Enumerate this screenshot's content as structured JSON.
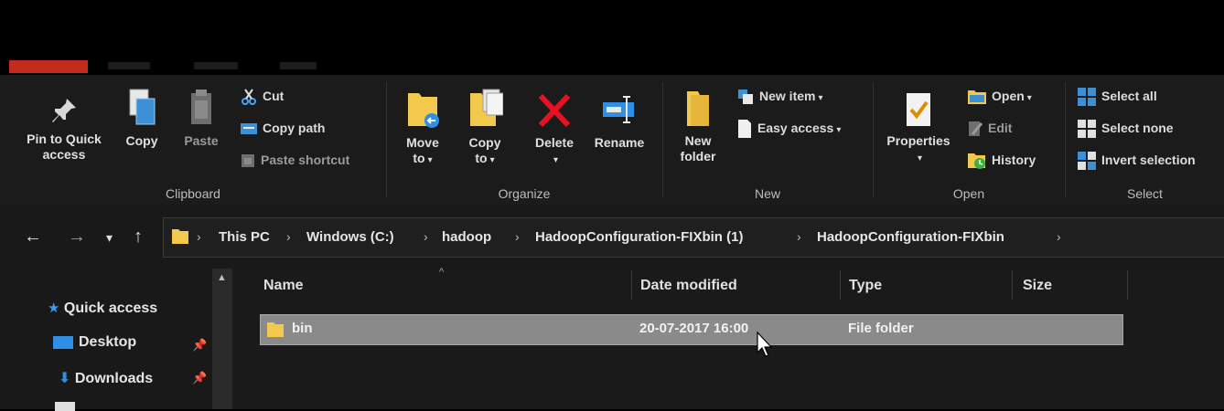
{
  "ribbon": {
    "clipboard": {
      "label": "Clipboard",
      "pin_line1": "Pin to Quick",
      "pin_line2": "access",
      "copy": "Copy",
      "paste": "Paste",
      "cut": "Cut",
      "copy_path": "Copy path",
      "paste_shortcut": "Paste shortcut"
    },
    "organize": {
      "label": "Organize",
      "move_line1": "Move",
      "move_line2": "to",
      "copy_line1": "Copy",
      "copy_line2": "to",
      "delete": "Delete",
      "rename": "Rename"
    },
    "new": {
      "label": "New",
      "folder_line1": "New",
      "folder_line2": "folder",
      "new_item": "New item",
      "easy_access": "Easy access"
    },
    "open": {
      "label": "Open",
      "properties": "Properties",
      "open": "Open",
      "edit": "Edit",
      "history": "History"
    },
    "select": {
      "label": "Select",
      "select_all": "Select all",
      "select_none": "Select none",
      "invert_selection": "Invert selection"
    }
  },
  "address": {
    "crumbs": [
      "This PC",
      "Windows (C:)",
      "hadoop",
      "HadoopConfiguration-FIXbin (1)",
      "HadoopConfiguration-FIXbin"
    ]
  },
  "nav": {
    "quick_access": "Quick access",
    "desktop": "Desktop",
    "downloads": "Downloads"
  },
  "columns": {
    "name": "Name",
    "date": "Date modified",
    "type": "Type",
    "size": "Size"
  },
  "rows": [
    {
      "name": "bin",
      "date": "20-07-2017 16:00",
      "type": "File folder",
      "size": ""
    }
  ],
  "colors": {
    "accent_tab": "#c42b1c",
    "selection": "#8a8a8a",
    "folder": "#f2c94c",
    "delete_x": "#e81123",
    "blue_icon": "#1e90ff"
  }
}
